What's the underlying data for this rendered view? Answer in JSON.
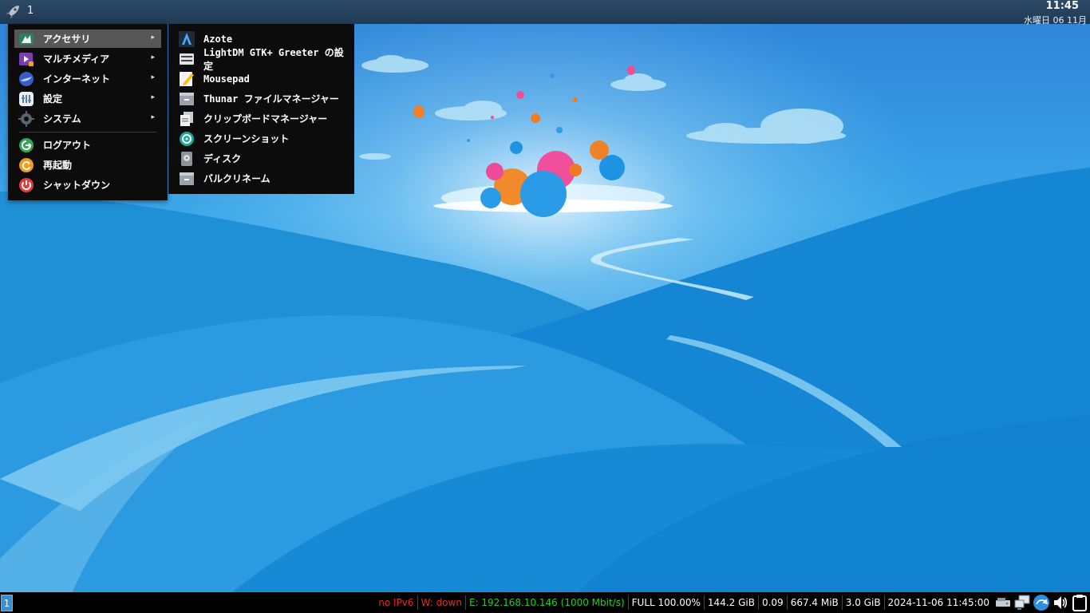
{
  "top_panel": {
    "workspace": "1",
    "clock_time": "11:45",
    "clock_date": "水曜日 06 11月"
  },
  "menu": {
    "items": [
      {
        "label": "アクセサリ",
        "icon": "accessories-icon",
        "has_submenu": true,
        "selected": true
      },
      {
        "label": "マルチメディア",
        "icon": "multimedia-icon",
        "has_submenu": true
      },
      {
        "label": "インターネット",
        "icon": "internet-icon",
        "has_submenu": true
      },
      {
        "label": "設定",
        "icon": "settings-icon",
        "has_submenu": true
      },
      {
        "label": "システム",
        "icon": "system-icon",
        "has_submenu": true
      },
      {
        "label": "ログアウト",
        "icon": "logout-icon"
      },
      {
        "label": "再起動",
        "icon": "reboot-icon"
      },
      {
        "label": "シャットダウン",
        "icon": "shutdown-icon"
      }
    ],
    "arrow": "▸"
  },
  "submenu": {
    "items": [
      {
        "label": "Azote",
        "icon": "azote-icon"
      },
      {
        "label": "LightDM GTK+ Greeter の設定",
        "icon": "lightdm-icon"
      },
      {
        "label": "Mousepad",
        "icon": "mousepad-icon"
      },
      {
        "label": "Thunar ファイルマネージャー",
        "icon": "thunar-icon"
      },
      {
        "label": "クリップボードマネージャー",
        "icon": "clipboard-icon"
      },
      {
        "label": "スクリーンショット",
        "icon": "screenshot-icon"
      },
      {
        "label": "ディスク",
        "icon": "disks-icon"
      },
      {
        "label": "バルクリネーム",
        "icon": "bulk-rename-icon"
      }
    ]
  },
  "bottom_bar": {
    "workspace": "1",
    "status": [
      {
        "text": "no IPv6",
        "color": "#e02a2a"
      },
      {
        "text": "W: down",
        "color": "#e02a2a"
      },
      {
        "text": "E: 192.168.10.146 (1000 Mbit/s)",
        "color": "#22d022"
      },
      {
        "text": "FULL 100.00%",
        "color": "#ffffff"
      },
      {
        "text": "144.2 GiB",
        "color": "#ffffff"
      },
      {
        "text": "0.09",
        "color": "#ffffff"
      },
      {
        "text": "667.4 MiB",
        "color": "#ffffff"
      },
      {
        "text": "3.0 GiB",
        "color": "#ffffff"
      },
      {
        "text": "2024-11-06 11:45:00",
        "color": "#ffffff"
      }
    ],
    "tray": [
      "removable-drive-icon",
      "network-wired-icon",
      "update-notifier-icon",
      "volume-icon",
      "clipboard-tray-icon"
    ]
  }
}
